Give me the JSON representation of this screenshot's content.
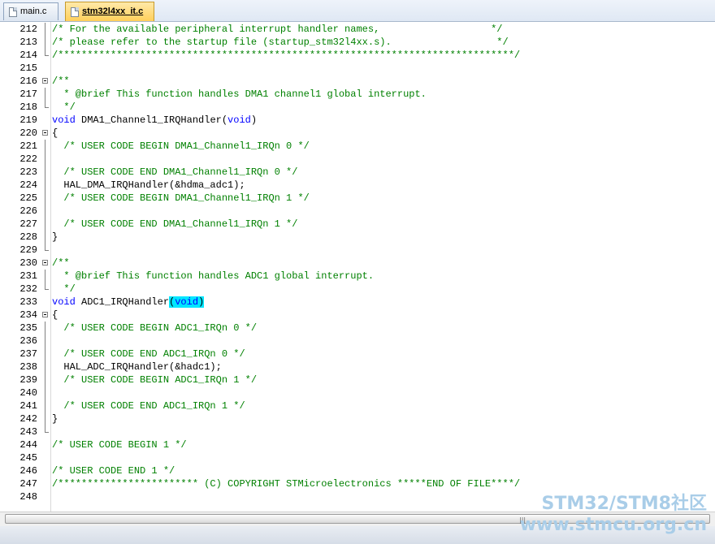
{
  "tabs": [
    {
      "label": "main.c",
      "active": false
    },
    {
      "label": "stm32l4xx_it.c",
      "active": true
    }
  ],
  "lines": [
    {
      "n": "212",
      "fold": "line",
      "segs": [
        {
          "t": "/* For the available peripheral interrupt handler names,                   */",
          "c": "c"
        }
      ]
    },
    {
      "n": "213",
      "fold": "line",
      "segs": [
        {
          "t": "/* please refer to the startup file (startup_stm32l4xx.s).                  */",
          "c": "c"
        }
      ]
    },
    {
      "n": "214",
      "fold": "end",
      "segs": [
        {
          "t": "/******************************************************************************/",
          "c": "c"
        }
      ]
    },
    {
      "n": "215",
      "fold": "",
      "segs": []
    },
    {
      "n": "216",
      "fold": "box",
      "segs": [
        {
          "t": "/**",
          "c": "c"
        }
      ]
    },
    {
      "n": "217",
      "fold": "line",
      "segs": [
        {
          "t": "  * @brief This function handles DMA1 channel1 global interrupt.",
          "c": "c"
        }
      ]
    },
    {
      "n": "218",
      "fold": "end",
      "segs": [
        {
          "t": "  */",
          "c": "c"
        }
      ]
    },
    {
      "n": "219",
      "fold": "",
      "segs": [
        {
          "t": "void",
          "c": "kw"
        },
        {
          "t": " DMA1_Channel1_IRQHandler(",
          "c": ""
        },
        {
          "t": "void",
          "c": "kw"
        },
        {
          "t": ")",
          "c": ""
        }
      ]
    },
    {
      "n": "220",
      "fold": "box",
      "segs": [
        {
          "t": "{",
          "c": ""
        }
      ]
    },
    {
      "n": "221",
      "fold": "line",
      "segs": [
        {
          "t": "  /* USER CODE BEGIN DMA1_Channel1_IRQn 0 */",
          "c": "c"
        }
      ]
    },
    {
      "n": "222",
      "fold": "line",
      "segs": []
    },
    {
      "n": "223",
      "fold": "line",
      "segs": [
        {
          "t": "  /* USER CODE END DMA1_Channel1_IRQn 0 */",
          "c": "c"
        }
      ]
    },
    {
      "n": "224",
      "fold": "line",
      "segs": [
        {
          "t": "  HAL_DMA_IRQHandler(&hdma_adc1);",
          "c": ""
        }
      ]
    },
    {
      "n": "225",
      "fold": "line",
      "segs": [
        {
          "t": "  /* USER CODE BEGIN DMA1_Channel1_IRQn 1 */",
          "c": "c"
        }
      ]
    },
    {
      "n": "226",
      "fold": "line",
      "segs": []
    },
    {
      "n": "227",
      "fold": "line",
      "segs": [
        {
          "t": "  /* USER CODE END DMA1_Channel1_IRQn 1 */",
          "c": "c"
        }
      ]
    },
    {
      "n": "228",
      "fold": "line",
      "segs": [
        {
          "t": "}",
          "c": ""
        }
      ]
    },
    {
      "n": "229",
      "fold": "end",
      "segs": []
    },
    {
      "n": "230",
      "fold": "box",
      "segs": [
        {
          "t": "/**",
          "c": "c"
        }
      ]
    },
    {
      "n": "231",
      "fold": "line",
      "segs": [
        {
          "t": "  * @brief This function handles ADC1 global interrupt.",
          "c": "c"
        }
      ]
    },
    {
      "n": "232",
      "fold": "end",
      "segs": [
        {
          "t": "  */",
          "c": "c"
        }
      ]
    },
    {
      "n": "233",
      "fold": "",
      "segs": [
        {
          "t": "void",
          "c": "kw"
        },
        {
          "t": " ADC1_IRQHandler",
          "c": ""
        },
        {
          "t": "(",
          "c": "hl"
        },
        {
          "t": "void",
          "c": "kw hl"
        },
        {
          "t": ")",
          "c": "hl"
        }
      ]
    },
    {
      "n": "234",
      "fold": "box",
      "segs": [
        {
          "t": "{",
          "c": ""
        }
      ]
    },
    {
      "n": "235",
      "fold": "line",
      "segs": [
        {
          "t": "  /* USER CODE BEGIN ADC1_IRQn 0 */",
          "c": "c"
        }
      ]
    },
    {
      "n": "236",
      "fold": "line",
      "segs": []
    },
    {
      "n": "237",
      "fold": "line",
      "segs": [
        {
          "t": "  /* USER CODE END ADC1_IRQn 0 */",
          "c": "c"
        }
      ]
    },
    {
      "n": "238",
      "fold": "line",
      "segs": [
        {
          "t": "  HAL_ADC_IRQHandler(&hadc1);",
          "c": ""
        }
      ]
    },
    {
      "n": "239",
      "fold": "line",
      "segs": [
        {
          "t": "  /* USER CODE BEGIN ADC1_IRQn 1 */",
          "c": "c"
        }
      ]
    },
    {
      "n": "240",
      "fold": "line",
      "segs": []
    },
    {
      "n": "241",
      "fold": "line",
      "segs": [
        {
          "t": "  /* USER CODE END ADC1_IRQn 1 */",
          "c": "c"
        }
      ]
    },
    {
      "n": "242",
      "fold": "line",
      "segs": [
        {
          "t": "}",
          "c": ""
        }
      ]
    },
    {
      "n": "243",
      "fold": "end",
      "segs": []
    },
    {
      "n": "244",
      "fold": "",
      "segs": [
        {
          "t": "/* USER CODE BEGIN 1 */",
          "c": "c"
        }
      ]
    },
    {
      "n": "245",
      "fold": "",
      "segs": []
    },
    {
      "n": "246",
      "fold": "",
      "segs": [
        {
          "t": "/* USER CODE END 1 */",
          "c": "c"
        }
      ]
    },
    {
      "n": "247",
      "fold": "",
      "segs": [
        {
          "t": "/************************ (C) COPYRIGHT STMicroelectronics *****END OF FILE****/",
          "c": "c"
        }
      ]
    },
    {
      "n": "248",
      "fold": "",
      "segs": []
    }
  ],
  "scrollbar": {
    "grip": "|||"
  },
  "watermark": {
    "line1": "STM32/STM8社区",
    "line2": "www.stmcu.org.cn"
  }
}
